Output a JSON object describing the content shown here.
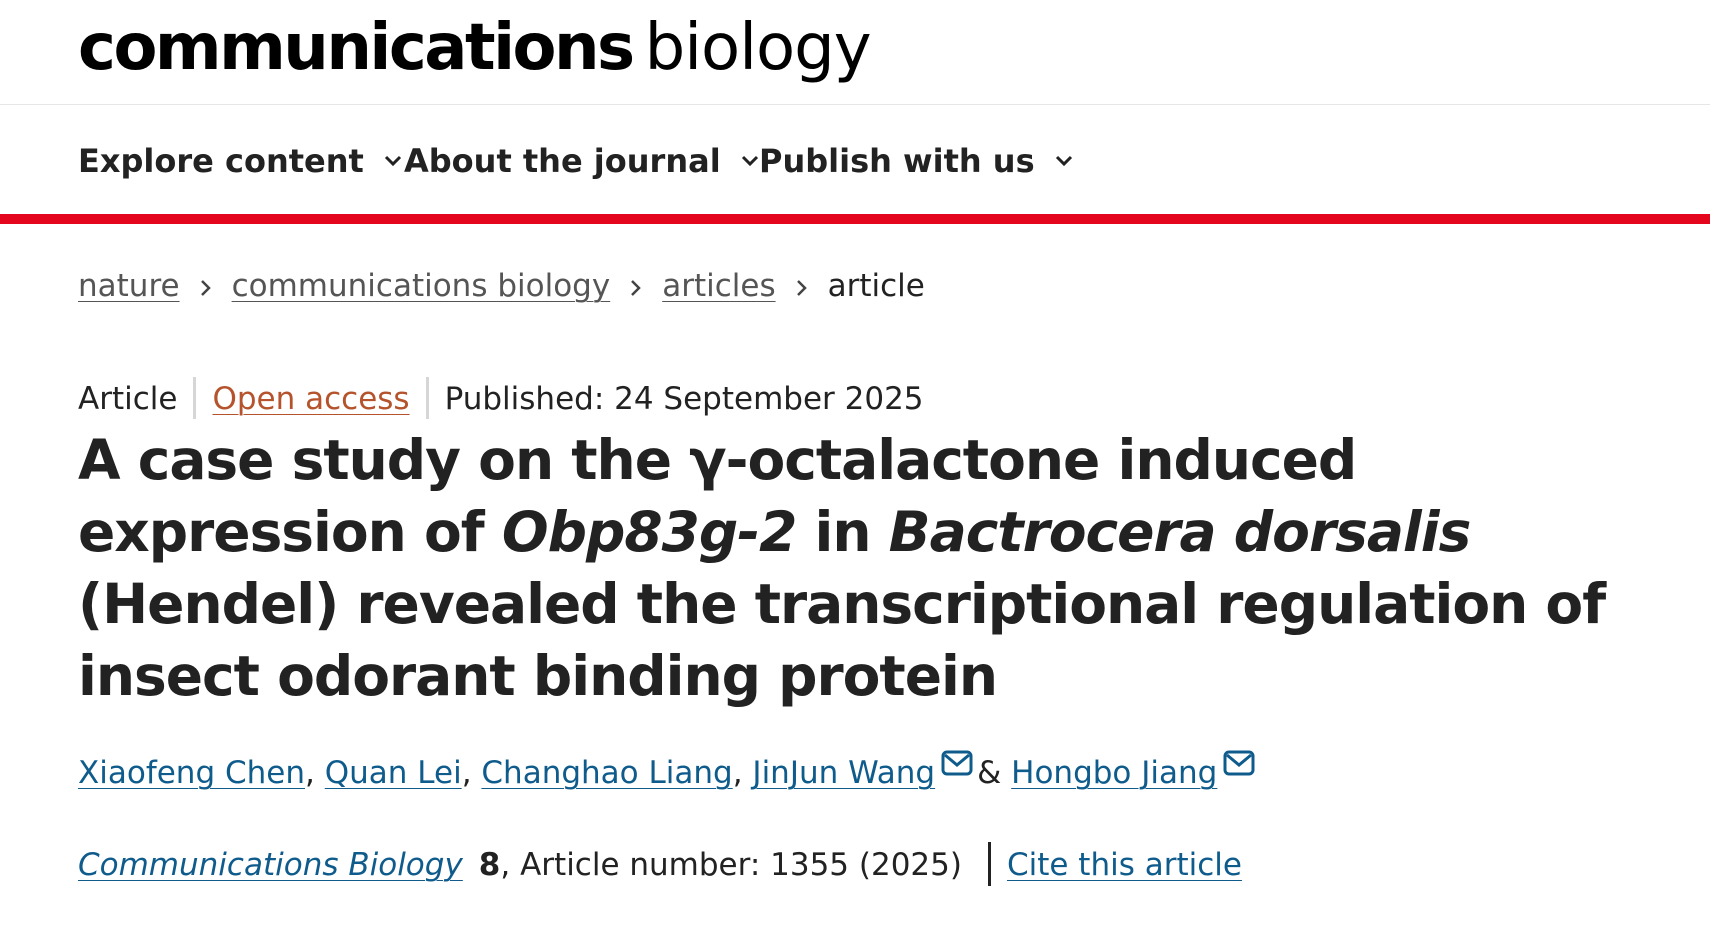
{
  "header": {
    "brand_main": "communications",
    "brand_sub": "biology"
  },
  "nav": {
    "items": [
      {
        "label": "Explore content",
        "icon": "chevron-down-icon"
      },
      {
        "label": "About the journal",
        "icon": "chevron-down-icon"
      },
      {
        "label": "Publish with us",
        "icon": "chevron-down-icon"
      }
    ]
  },
  "colors": {
    "accent_bar": "#e3061c",
    "link": "#0f5c8c",
    "open_access": "#b5532c"
  },
  "breadcrumb": {
    "items": [
      "nature",
      "communications biology",
      "articles"
    ],
    "current": "article",
    "separator_icon": "chevron-right-icon"
  },
  "meta": {
    "type": "Article",
    "access": "Open access",
    "published": "Published: 24 September 2025"
  },
  "article": {
    "title_part1": "A case study on the γ-octalactone induced expression of ",
    "title_gene": "Obp83g-2",
    "title_part2": " in ",
    "title_species": "Bactrocera dorsalis",
    "title_part3": " (Hendel) revealed the transcriptional regulation of insect odorant binding protein"
  },
  "authors": {
    "list": [
      "Xiaofeng Chen",
      "Quan Lei",
      "Changhao Liang",
      "JinJun Wang",
      "Hongbo Jiang"
    ],
    "separator": ", ",
    "ampersand": "&",
    "email_icon": "email-icon"
  },
  "citation": {
    "journal": "Communications Biology",
    "volume": "8",
    "article_number": ", Article number: 1355 (2025)",
    "cite_label": "Cite this article"
  }
}
